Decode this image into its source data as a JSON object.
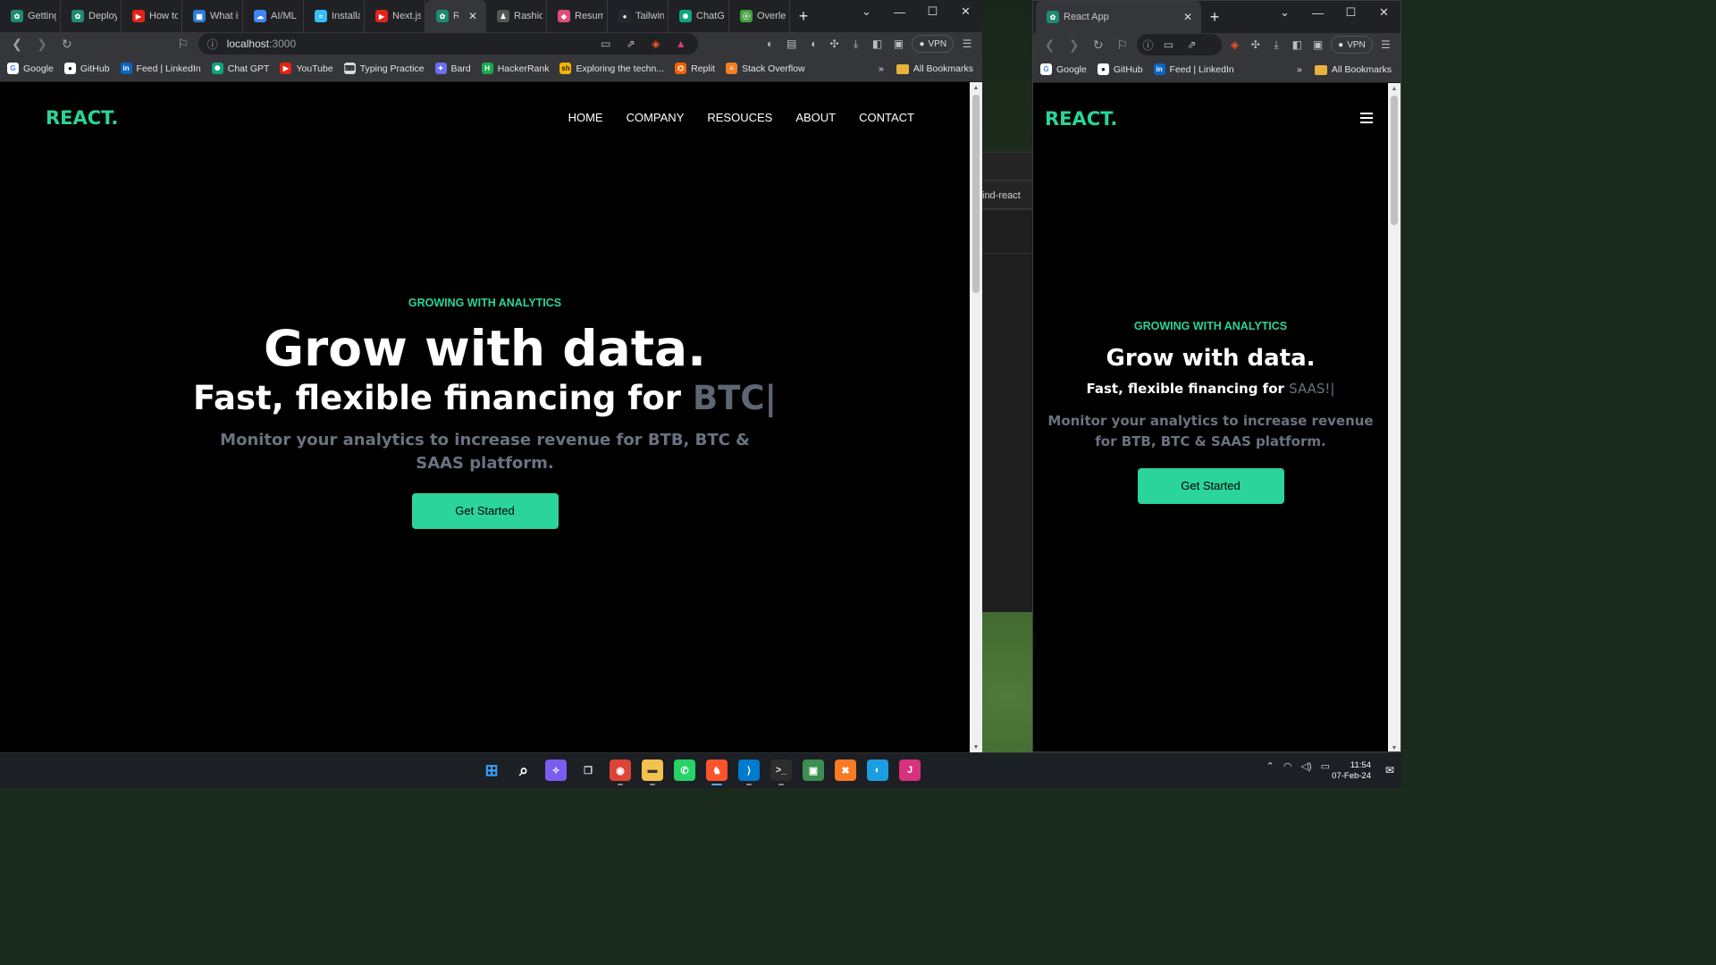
{
  "main_browser": {
    "tabs": [
      {
        "label": "Getting S",
        "color": "#1e8a72",
        "glyph": "✿"
      },
      {
        "label": "Deploym",
        "color": "#1e8a72",
        "glyph": "✿"
      },
      {
        "label": "How to (",
        "color": "#e62117",
        "glyph": "▶"
      },
      {
        "label": "What is a",
        "color": "#2f7ad6",
        "glyph": "▦"
      },
      {
        "label": "AI/ML fr",
        "color": "#4285f4",
        "glyph": "☁"
      },
      {
        "label": "Installati",
        "color": "#38bdf8",
        "glyph": "≈"
      },
      {
        "label": "Next.js,",
        "color": "#e62117",
        "glyph": "▶"
      },
      {
        "label": "Reac",
        "color": "#1e8a72",
        "glyph": "✿",
        "active": true,
        "close": "✕"
      },
      {
        "label": "Rashid S",
        "color": "#555555",
        "glyph": "♟"
      },
      {
        "label": "Resume",
        "color": "#e14d7a",
        "glyph": "◆"
      },
      {
        "label": "Tailwind",
        "color": "#24292f",
        "glyph": "●"
      },
      {
        "label": "ChatGPT",
        "color": "#10a37f",
        "glyph": "✺"
      },
      {
        "label": "Overleaf",
        "color": "#47a141",
        "glyph": "ⓞ"
      }
    ],
    "new_tab": "+",
    "window_controls": [
      "⌄",
      "—",
      "☐",
      "✕"
    ],
    "address": "localhost",
    "port": ":3000",
    "vpn_label": "VPN",
    "bookmarks": [
      {
        "label": "Google",
        "color": "#ffffff",
        "text": "#4285f4",
        "glyph": "G"
      },
      {
        "label": "GitHub",
        "color": "#ffffff",
        "text": "#111111",
        "glyph": "●"
      },
      {
        "label": "Feed | LinkedIn",
        "color": "#0a66c2",
        "text": "#ffffff",
        "glyph": "in"
      },
      {
        "label": "Chat GPT",
        "color": "#10a37f",
        "text": "#ffffff",
        "glyph": "✺"
      },
      {
        "label": "YouTube",
        "color": "#e62117",
        "text": "#ffffff",
        "glyph": "▶"
      },
      {
        "label": "Typing Practice",
        "color": "#dddddd",
        "text": "#333333",
        "glyph": "⌨"
      },
      {
        "label": "Bard",
        "color": "#6c6ff2",
        "text": "#ffffff",
        "glyph": "✦"
      },
      {
        "label": "HackerRank",
        "color": "#1ba94c",
        "text": "#ffffff",
        "glyph": "H"
      },
      {
        "label": "Exploring the techn...",
        "color": "#f5b400",
        "text": "#222222",
        "glyph": "sh"
      },
      {
        "label": "Replit",
        "color": "#f26207",
        "text": "#ffffff",
        "glyph": "⌬"
      },
      {
        "label": "Stack Overflow",
        "color": "#f48024",
        "text": "#ffffff",
        "glyph": "≡"
      }
    ],
    "bookmarks_more": "»",
    "all_bookmarks": "All Bookmarks"
  },
  "side_browser": {
    "tab_label": "React App",
    "tab_close": "✕",
    "new_tab": "+",
    "window_controls": [
      "⌄",
      "—",
      "☐",
      "✕"
    ],
    "vpn_label": "VPN",
    "bookmarks": [
      {
        "label": "Google",
        "color": "#ffffff",
        "text": "#4285f4",
        "glyph": "G"
      },
      {
        "label": "GitHub",
        "color": "#ffffff",
        "text": "#111111",
        "glyph": "●"
      },
      {
        "label": "Feed | LinkedIn",
        "color": "#0a66c2",
        "text": "#ffffff",
        "glyph": "in"
      }
    ],
    "bookmarks_more": "»",
    "all_bookmarks": "All Bookmarks"
  },
  "site": {
    "logo": "REACT.",
    "nav": [
      "HOME",
      "COMPANY",
      "RESOUCES",
      "ABOUT",
      "CONTACT"
    ],
    "kicker": "GROWING WITH ANALYTICS",
    "headline": "Grow with data.",
    "subheadline": "Fast, flexible financing for",
    "typed_main": "BTC|",
    "typed_side": "SAAS!|",
    "description": "Monitor your analytics to increase revenue for BTB, BTC & SAAS platform.",
    "cta": "Get Started",
    "accent": "#2ad49a"
  },
  "background_window": {
    "text": "ind-react"
  },
  "taskbar": {
    "apps": [
      {
        "name": "start-icon",
        "glyph": "⊞",
        "color": "#3aa0ff",
        "bg": "transparent"
      },
      {
        "name": "search-icon",
        "glyph": "⌕",
        "color": "#ffffff",
        "bg": "transparent"
      },
      {
        "name": "copilot-icon",
        "glyph": "✧",
        "color": "#ffffff",
        "bg": "#7a5cf0"
      },
      {
        "name": "task-view-icon",
        "glyph": "❐",
        "color": "#dddddd",
        "bg": "transparent"
      },
      {
        "name": "chrome-icon",
        "glyph": "◉",
        "color": "#ffffff",
        "bg": "#db4437",
        "running": true
      },
      {
        "name": "file-explorer-icon",
        "glyph": "▬",
        "color": "#333333",
        "bg": "#f2c14e",
        "running": true
      },
      {
        "name": "whatsapp-icon",
        "glyph": "✆",
        "color": "#ffffff",
        "bg": "#25d366"
      },
      {
        "name": "brave-icon",
        "glyph": "♞",
        "color": "#ffffff",
        "bg": "#fb542b",
        "running": true,
        "focused": true
      },
      {
        "name": "vscode-icon",
        "glyph": "⟩",
        "color": "#ffffff",
        "bg": "#007acc",
        "running": true
      },
      {
        "name": "terminal-icon",
        "glyph": ">_",
        "color": "#dddddd",
        "bg": "#2d2d2d",
        "running": true
      },
      {
        "name": "paint-icon",
        "glyph": "▣",
        "color": "#ffffff",
        "bg": "#3b8e4f"
      },
      {
        "name": "xampp-icon",
        "glyph": "✖",
        "color": "#ffffff",
        "bg": "#fb7a24"
      },
      {
        "name": "edge-icon",
        "glyph": "◐",
        "color": "#ffffff",
        "bg": "#1b9de2"
      },
      {
        "name": "jetbrains-icon",
        "glyph": "J",
        "color": "#ffffff",
        "bg": "#d8317d"
      }
    ],
    "time": "11:54",
    "date": "07-Feb-24"
  }
}
